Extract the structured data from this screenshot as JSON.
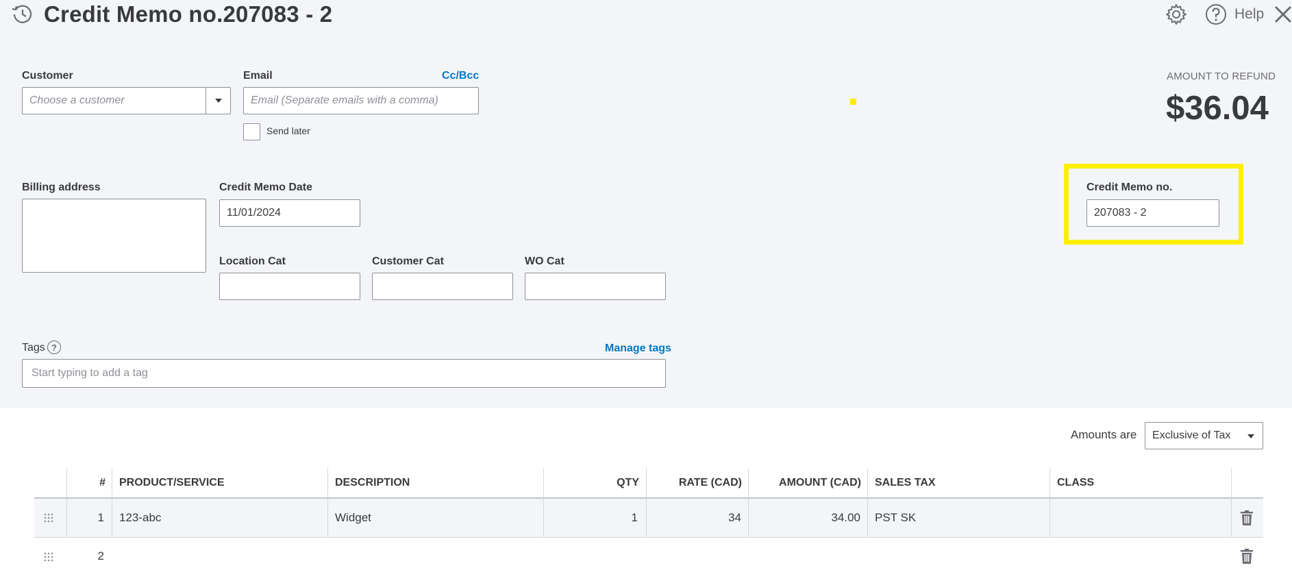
{
  "header": {
    "title": "Credit Memo no.207083 - 2",
    "help_label": "Help"
  },
  "customer": {
    "label": "Customer",
    "placeholder": "Choose a customer"
  },
  "email": {
    "label": "Email",
    "cc_bcc_link": "Cc/Bcc",
    "placeholder": "Email (Separate emails with a comma)",
    "send_later_label": "Send later"
  },
  "refund": {
    "label": "AMOUNT TO REFUND",
    "amount": "$36.04"
  },
  "billing": {
    "label": "Billing address",
    "value": ""
  },
  "credit_memo_date": {
    "label": "Credit Memo Date",
    "value": "11/01/2024"
  },
  "credit_memo_no": {
    "label": "Credit Memo no.",
    "value": "207083 - 2"
  },
  "custom_fields": [
    {
      "label": "Location Cat",
      "value": ""
    },
    {
      "label": "Customer Cat",
      "value": ""
    },
    {
      "label": "WO Cat",
      "value": ""
    }
  ],
  "tags": {
    "label": "Tags",
    "help": "?",
    "manage_link": "Manage tags",
    "placeholder": "Start typing to add a tag"
  },
  "amounts_are": {
    "label": "Amounts are",
    "value": "Exclusive of Tax"
  },
  "table": {
    "headers": {
      "num": "#",
      "product": "PRODUCT/SERVICE",
      "description": "DESCRIPTION",
      "qty": "QTY",
      "rate": "RATE (CAD)",
      "amount": "AMOUNT (CAD)",
      "sales_tax": "SALES TAX",
      "class": "CLASS"
    },
    "rows": [
      {
        "num": "1",
        "product": "123-abc",
        "description": "Widget",
        "qty": "1",
        "rate": "34",
        "amount": "34.00",
        "sales_tax": "PST SK",
        "class": ""
      },
      {
        "num": "2",
        "product": "",
        "description": "",
        "qty": "",
        "rate": "",
        "amount": "",
        "sales_tax": "",
        "class": ""
      }
    ]
  },
  "colors": {
    "accent": "#0077c5",
    "highlight": "#ffee00",
    "panel_bg": "#f4f5f8"
  },
  "icons": [
    "history-icon",
    "gear-icon",
    "help-icon",
    "close-icon",
    "chevron-down-icon",
    "drag-handle-icon",
    "trash-icon"
  ]
}
